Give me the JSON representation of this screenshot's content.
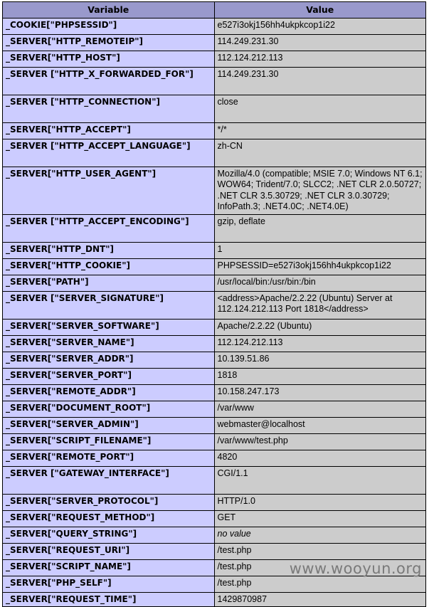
{
  "header": {
    "variable": "Variable",
    "value": "Value"
  },
  "rows": [
    {
      "key": "_COOKIE[\"PHPSESSID\"]",
      "value": "e527i3okj156hh4ukpkcop1i22",
      "lines": 1
    },
    {
      "key": "_SERVER[\"HTTP_REMOTEIP\"]",
      "value": "114.249.231.30",
      "lines": 1
    },
    {
      "key": "_SERVER[\"HTTP_HOST\"]",
      "value": "112.124.212.113",
      "lines": 1
    },
    {
      "key": "_SERVER [\"HTTP_X_FORWARDED_FOR\"]",
      "value": "114.249.231.30",
      "lines": 2
    },
    {
      "key": "_SERVER [\"HTTP_CONNECTION\"]",
      "value": "close",
      "lines": 2
    },
    {
      "key": "_SERVER[\"HTTP_ACCEPT\"]",
      "value": "*/*",
      "lines": 1
    },
    {
      "key": "_SERVER [\"HTTP_ACCEPT_LANGUAGE\"]",
      "value": "zh-CN",
      "lines": 2
    },
    {
      "key": "_SERVER[\"HTTP_USER_AGENT\"]",
      "value": "Mozilla/4.0 (compatible; MSIE 7.0; Windows NT 6.1; WOW64; Trident/7.0; SLCC2; .NET CLR 2.0.50727; .NET CLR 3.5.30729; .NET CLR 3.0.30729; InfoPath.3; .NET4.0C; .NET4.0E)",
      "lines": 3
    },
    {
      "key": "_SERVER [\"HTTP_ACCEPT_ENCODING\"]",
      "value": "gzip, deflate",
      "lines": 2
    },
    {
      "key": "_SERVER[\"HTTP_DNT\"]",
      "value": "1",
      "lines": 1
    },
    {
      "key": "_SERVER[\"HTTP_COOKIE\"]",
      "value": "PHPSESSID=e527i3okj156hh4ukpkcop1i22",
      "lines": 1
    },
    {
      "key": "_SERVER[\"PATH\"]",
      "value": "/usr/local/bin:/usr/bin:/bin",
      "lines": 1
    },
    {
      "key": "_SERVER [\"SERVER_SIGNATURE\"]",
      "value": "<address>Apache/2.2.22 (Ubuntu) Server at 112.124.212.113 Port 1818</address>",
      "lines": 2
    },
    {
      "key": "_SERVER[\"SERVER_SOFTWARE\"]",
      "value": "Apache/2.2.22 (Ubuntu)",
      "lines": 1
    },
    {
      "key": "_SERVER[\"SERVER_NAME\"]",
      "value": "112.124.212.113",
      "lines": 1
    },
    {
      "key": "_SERVER[\"SERVER_ADDR\"]",
      "value": "10.139.51.86",
      "lines": 1
    },
    {
      "key": "_SERVER[\"SERVER_PORT\"]",
      "value": "1818",
      "lines": 1
    },
    {
      "key": "_SERVER[\"REMOTE_ADDR\"]",
      "value": "10.158.247.173",
      "lines": 1
    },
    {
      "key": "_SERVER[\"DOCUMENT_ROOT\"]",
      "value": "/var/www",
      "lines": 1
    },
    {
      "key": "_SERVER[\"SERVER_ADMIN\"]",
      "value": "webmaster@localhost",
      "lines": 1
    },
    {
      "key": "_SERVER[\"SCRIPT_FILENAME\"]",
      "value": "/var/www/test.php",
      "lines": 1
    },
    {
      "key": "_SERVER[\"REMOTE_PORT\"]",
      "value": "4820",
      "lines": 1
    },
    {
      "key": "_SERVER [\"GATEWAY_INTERFACE\"]",
      "value": "CGI/1.1",
      "lines": 2
    },
    {
      "key": "_SERVER[\"SERVER_PROTOCOL\"]",
      "value": "HTTP/1.0",
      "lines": 1
    },
    {
      "key": "_SERVER[\"REQUEST_METHOD\"]",
      "value": "GET",
      "lines": 1
    },
    {
      "key": "_SERVER[\"QUERY_STRING\"]",
      "value": "no value",
      "lines": 1,
      "novalue": true
    },
    {
      "key": "_SERVER[\"REQUEST_URI\"]",
      "value": "/test.php",
      "lines": 1
    },
    {
      "key": "_SERVER[\"SCRIPT_NAME\"]",
      "value": "/test.php",
      "lines": 1
    },
    {
      "key": "_SERVER[\"PHP_SELF\"]",
      "value": "/test.php",
      "lines": 1
    },
    {
      "key": "_SERVER[\"REQUEST_TIME\"]",
      "value": "1429870987",
      "lines": 1,
      "truncated": true
    }
  ],
  "watermark": "www.wooyun.org"
}
